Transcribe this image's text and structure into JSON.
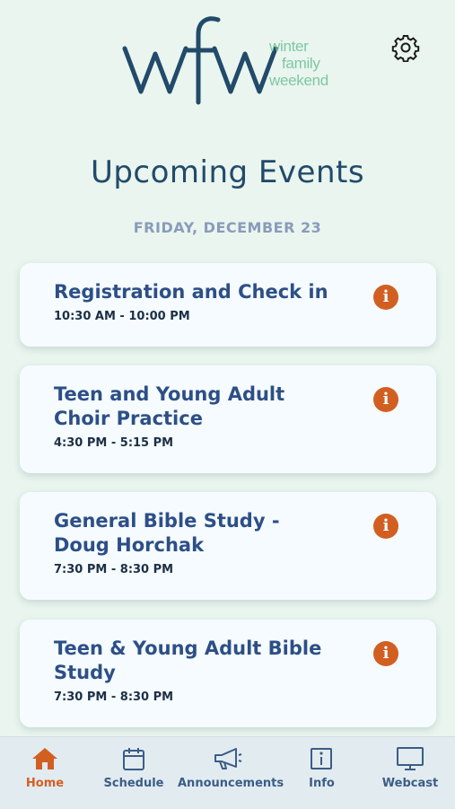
{
  "header": {
    "logo_text": "wfw",
    "logo_tagline": [
      "winter",
      "family",
      "weekend"
    ]
  },
  "page_title": "Upcoming Events",
  "date_heading": "FRIDAY, DECEMBER 23",
  "events": [
    {
      "title": "Registration and Check in",
      "time": "10:30 AM - 10:00 PM"
    },
    {
      "title": "Teen and Young Adult Choir Practice",
      "time": "4:30 PM - 5:15 PM"
    },
    {
      "title": "General Bible Study - Doug Horchak",
      "time": "7:30 PM - 8:30 PM"
    },
    {
      "title": "Teen & Young Adult Bible Study",
      "time": "7:30 PM - 8:30 PM"
    }
  ],
  "info_glyph": "i",
  "tabs": [
    {
      "label": "Home",
      "icon": "home-icon",
      "active": true
    },
    {
      "label": "Schedule",
      "icon": "calendar-icon",
      "active": false
    },
    {
      "label": "Announcements",
      "icon": "megaphone-icon",
      "active": false
    },
    {
      "label": "Info",
      "icon": "info-icon",
      "active": false
    },
    {
      "label": "Webcast",
      "icon": "monitor-icon",
      "active": false
    }
  ],
  "colors": {
    "background": "#e9f5ee",
    "brand_navy": "#224a6a",
    "brand_green": "#7fc7a4",
    "accent_orange": "#d25f22",
    "card_bg": "#f5fbfe",
    "tab_inactive": "#3b5d86"
  }
}
